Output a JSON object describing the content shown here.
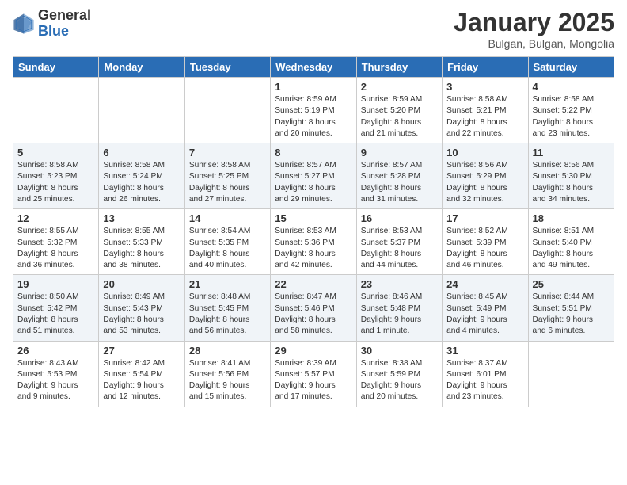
{
  "logo": {
    "general": "General",
    "blue": "Blue"
  },
  "header": {
    "month": "January 2025",
    "location": "Bulgan, Bulgan, Mongolia"
  },
  "weekdays": [
    "Sunday",
    "Monday",
    "Tuesday",
    "Wednesday",
    "Thursday",
    "Friday",
    "Saturday"
  ],
  "weeks": [
    [
      {
        "day": "",
        "info": ""
      },
      {
        "day": "",
        "info": ""
      },
      {
        "day": "",
        "info": ""
      },
      {
        "day": "1",
        "info": "Sunrise: 8:59 AM\nSunset: 5:19 PM\nDaylight: 8 hours\nand 20 minutes."
      },
      {
        "day": "2",
        "info": "Sunrise: 8:59 AM\nSunset: 5:20 PM\nDaylight: 8 hours\nand 21 minutes."
      },
      {
        "day": "3",
        "info": "Sunrise: 8:58 AM\nSunset: 5:21 PM\nDaylight: 8 hours\nand 22 minutes."
      },
      {
        "day": "4",
        "info": "Sunrise: 8:58 AM\nSunset: 5:22 PM\nDaylight: 8 hours\nand 23 minutes."
      }
    ],
    [
      {
        "day": "5",
        "info": "Sunrise: 8:58 AM\nSunset: 5:23 PM\nDaylight: 8 hours\nand 25 minutes."
      },
      {
        "day": "6",
        "info": "Sunrise: 8:58 AM\nSunset: 5:24 PM\nDaylight: 8 hours\nand 26 minutes."
      },
      {
        "day": "7",
        "info": "Sunrise: 8:58 AM\nSunset: 5:25 PM\nDaylight: 8 hours\nand 27 minutes."
      },
      {
        "day": "8",
        "info": "Sunrise: 8:57 AM\nSunset: 5:27 PM\nDaylight: 8 hours\nand 29 minutes."
      },
      {
        "day": "9",
        "info": "Sunrise: 8:57 AM\nSunset: 5:28 PM\nDaylight: 8 hours\nand 31 minutes."
      },
      {
        "day": "10",
        "info": "Sunrise: 8:56 AM\nSunset: 5:29 PM\nDaylight: 8 hours\nand 32 minutes."
      },
      {
        "day": "11",
        "info": "Sunrise: 8:56 AM\nSunset: 5:30 PM\nDaylight: 8 hours\nand 34 minutes."
      }
    ],
    [
      {
        "day": "12",
        "info": "Sunrise: 8:55 AM\nSunset: 5:32 PM\nDaylight: 8 hours\nand 36 minutes."
      },
      {
        "day": "13",
        "info": "Sunrise: 8:55 AM\nSunset: 5:33 PM\nDaylight: 8 hours\nand 38 minutes."
      },
      {
        "day": "14",
        "info": "Sunrise: 8:54 AM\nSunset: 5:35 PM\nDaylight: 8 hours\nand 40 minutes."
      },
      {
        "day": "15",
        "info": "Sunrise: 8:53 AM\nSunset: 5:36 PM\nDaylight: 8 hours\nand 42 minutes."
      },
      {
        "day": "16",
        "info": "Sunrise: 8:53 AM\nSunset: 5:37 PM\nDaylight: 8 hours\nand 44 minutes."
      },
      {
        "day": "17",
        "info": "Sunrise: 8:52 AM\nSunset: 5:39 PM\nDaylight: 8 hours\nand 46 minutes."
      },
      {
        "day": "18",
        "info": "Sunrise: 8:51 AM\nSunset: 5:40 PM\nDaylight: 8 hours\nand 49 minutes."
      }
    ],
    [
      {
        "day": "19",
        "info": "Sunrise: 8:50 AM\nSunset: 5:42 PM\nDaylight: 8 hours\nand 51 minutes."
      },
      {
        "day": "20",
        "info": "Sunrise: 8:49 AM\nSunset: 5:43 PM\nDaylight: 8 hours\nand 53 minutes."
      },
      {
        "day": "21",
        "info": "Sunrise: 8:48 AM\nSunset: 5:45 PM\nDaylight: 8 hours\nand 56 minutes."
      },
      {
        "day": "22",
        "info": "Sunrise: 8:47 AM\nSunset: 5:46 PM\nDaylight: 8 hours\nand 58 minutes."
      },
      {
        "day": "23",
        "info": "Sunrise: 8:46 AM\nSunset: 5:48 PM\nDaylight: 9 hours\nand 1 minute."
      },
      {
        "day": "24",
        "info": "Sunrise: 8:45 AM\nSunset: 5:49 PM\nDaylight: 9 hours\nand 4 minutes."
      },
      {
        "day": "25",
        "info": "Sunrise: 8:44 AM\nSunset: 5:51 PM\nDaylight: 9 hours\nand 6 minutes."
      }
    ],
    [
      {
        "day": "26",
        "info": "Sunrise: 8:43 AM\nSunset: 5:53 PM\nDaylight: 9 hours\nand 9 minutes."
      },
      {
        "day": "27",
        "info": "Sunrise: 8:42 AM\nSunset: 5:54 PM\nDaylight: 9 hours\nand 12 minutes."
      },
      {
        "day": "28",
        "info": "Sunrise: 8:41 AM\nSunset: 5:56 PM\nDaylight: 9 hours\nand 15 minutes."
      },
      {
        "day": "29",
        "info": "Sunrise: 8:39 AM\nSunset: 5:57 PM\nDaylight: 9 hours\nand 17 minutes."
      },
      {
        "day": "30",
        "info": "Sunrise: 8:38 AM\nSunset: 5:59 PM\nDaylight: 9 hours\nand 20 minutes."
      },
      {
        "day": "31",
        "info": "Sunrise: 8:37 AM\nSunset: 6:01 PM\nDaylight: 9 hours\nand 23 minutes."
      },
      {
        "day": "",
        "info": ""
      }
    ]
  ],
  "alt_rows": [
    1,
    3
  ]
}
